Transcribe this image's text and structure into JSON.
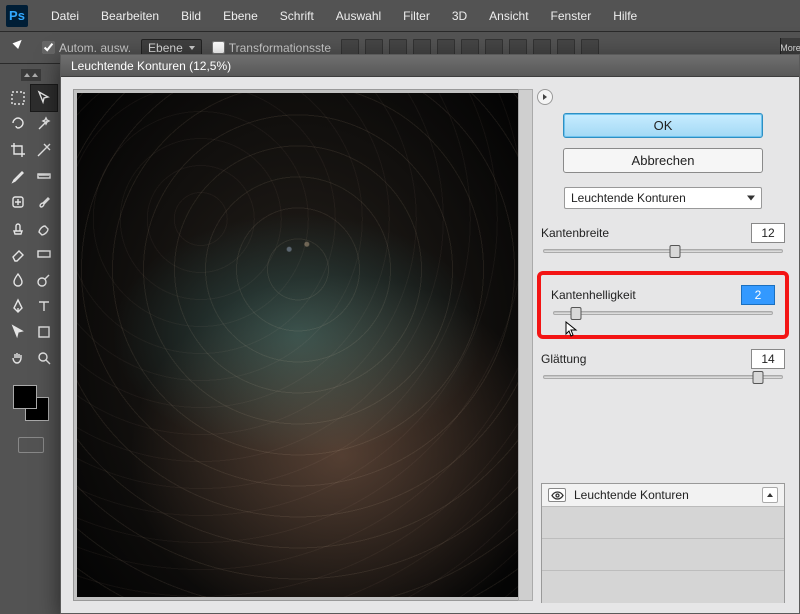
{
  "app": {
    "logo": "Ps"
  },
  "menubar": [
    "Datei",
    "Bearbeiten",
    "Bild",
    "Ebene",
    "Schrift",
    "Auswahl",
    "Filter",
    "3D",
    "Ansicht",
    "Fenster",
    "Hilfe"
  ],
  "optionsbar": {
    "autoselect_label": "Autom. ausw.",
    "mode_label": "Ebene",
    "transform_label": "Transformationsste"
  },
  "more_tab": "More",
  "tools": {
    "left": [
      "marquee",
      "lasso",
      "crop",
      "eyedropper",
      "brush",
      "clone",
      "eraser",
      "gradient",
      "blur",
      "pen",
      "path-select",
      "hand"
    ],
    "right": [
      "move",
      "magic-wand",
      "slice",
      "ruler",
      "healing",
      "history-brush",
      "paint-bucket",
      "dodge",
      "type",
      "shape",
      "direct-select",
      "zoom"
    ]
  },
  "filter_window": {
    "title": "Leuchtende Konturen (12,5%)",
    "ok_label": "OK",
    "cancel_label": "Abbrechen",
    "effect_select": "Leuchtende Konturen",
    "params": {
      "kantenbreite": {
        "label": "Kantenbreite",
        "value": "12",
        "slider": 55
      },
      "kantenhelligkeit": {
        "label": "Kantenhelligkeit",
        "value": "2",
        "slider": 10
      },
      "glattung": {
        "label": "Glättung",
        "value": "14",
        "slider": 90
      }
    },
    "stack_label": "Leuchtende Konturen"
  }
}
